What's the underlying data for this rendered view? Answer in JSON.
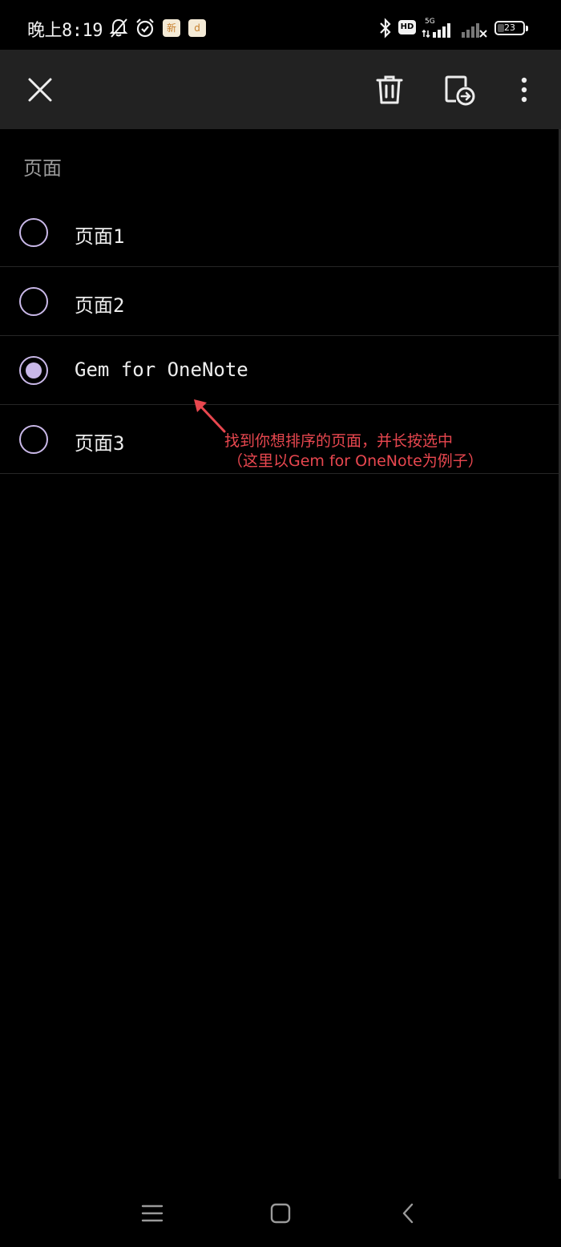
{
  "status_bar": {
    "time": "晚上8:19",
    "app_badge_1": "新",
    "app_badge_2": "d",
    "hd_label": "HD",
    "network_label": "5G",
    "battery_level": "23",
    "battery_percent": 23,
    "icons": [
      "notifications-off-icon",
      "alarm-icon",
      "bluetooth-icon",
      "signal-icon",
      "signal-no-service-icon",
      "battery-icon"
    ]
  },
  "toolbar": {
    "close_icon": "close-icon",
    "delete_icon": "trash-icon",
    "move_icon": "move-page-icon",
    "more_icon": "more-vert-icon"
  },
  "section": {
    "header": "页面"
  },
  "pages": [
    {
      "title": "页面1",
      "selected": false
    },
    {
      "title": "页面2",
      "selected": false
    },
    {
      "title": "Gem for OneNote",
      "selected": true
    },
    {
      "title": "页面3",
      "selected": false
    }
  ],
  "annotation": {
    "line1": "找到你想排序的页面，并长按选中",
    "line2": "（这里以Gem for OneNote为例子）",
    "color": "#e8474f"
  },
  "nav_bar": {
    "icons": [
      "menu-icon",
      "home-icon",
      "back-icon"
    ]
  },
  "colors": {
    "background": "#000000",
    "toolbar": "#222222",
    "accent": "#c9b8e8",
    "text": "#ededed",
    "muted": "#9a9a9a"
  }
}
